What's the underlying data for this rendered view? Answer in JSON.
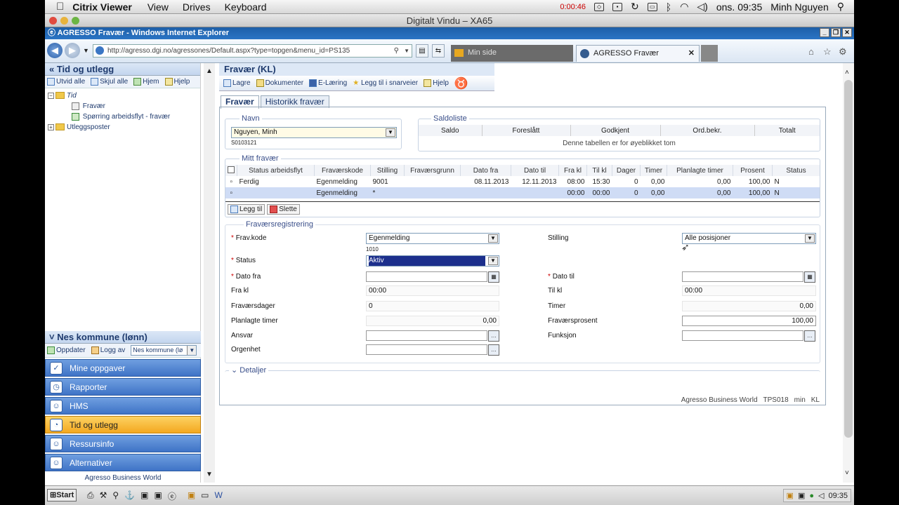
{
  "mac": {
    "apple": "",
    "app": "Citrix Viewer",
    "menus": [
      "View",
      "Drives",
      "Keyboard"
    ],
    "timer": "0:00:46",
    "clock": "ons. 09:35",
    "user": "Minh Nguyen"
  },
  "citrix": {
    "title": "Digitalt Vindu – XA65"
  },
  "ie": {
    "title": "AGRESSO Fravær - Windows Internet Explorer",
    "url": "http://agresso.dgi.no/agressones/Default.aspx?type=topgen&menu_id=PS135",
    "tab1": "Min side",
    "tab2": "AGRESSO Fravær",
    "close": "✕"
  },
  "left": {
    "heading": "Tid og utlegg",
    "tools": [
      "Utvid alle",
      "Skjul alle",
      "Hjem",
      "Hjelp"
    ],
    "tree": {
      "root": "Tid",
      "child1": "Fravær",
      "child2": "Spørring arbeidsflyt - fravær",
      "other": "Utleggsposter"
    },
    "company": "Nes kommune (lønn)",
    "tools2": [
      "Oppdater",
      "Logg av"
    ],
    "company_select": "Nes kommune (lø",
    "nav": [
      "Mine oppgaver",
      "Rapporter",
      "HMS",
      "Tid og utlegg",
      "Ressursinfo",
      "Alternativer"
    ],
    "footer": "Agresso Business World"
  },
  "page": {
    "title": "Fravær (KL)",
    "toolbar": [
      "Lagre",
      "Dokumenter",
      "E-Læring",
      "Legg til i snarveier",
      "Hjelp"
    ],
    "tabs": [
      "Fravær",
      "Historikk fravær"
    ],
    "navn": {
      "label": "Navn",
      "value": "Nguyen, Minh",
      "id": "S0103121"
    },
    "saldo": {
      "label": "Saldoliste",
      "cols": [
        "Saldo",
        "Foreslått",
        "Godkjent",
        "Ord.bekr.",
        "Totalt"
      ],
      "empty": "Denne tabellen er for øyeblikket tom"
    },
    "mitt": {
      "label": "Mitt fravær",
      "cols": [
        "Status arbeidsflyt",
        "Fraværskode",
        "Stilling",
        "Fraværsgrunn",
        "Dato fra",
        "Dato til",
        "Fra kl",
        "Til kl",
        "Dager",
        "Timer",
        "Planlagte timer",
        "Prosent",
        "Status"
      ],
      "rows": [
        [
          "Ferdig",
          "Egenmelding",
          "9001",
          "",
          "08.11.2013",
          "12.11.2013",
          "08:00",
          "15:30",
          "0",
          "0,00",
          "0,00",
          "100,00",
          "N"
        ],
        [
          "",
          "Egenmelding",
          "*",
          "",
          "",
          "",
          "00:00",
          "00:00",
          "0",
          "0,00",
          "0,00",
          "100,00",
          "N"
        ]
      ],
      "add": "Legg til",
      "delete": "Slette"
    },
    "reg": {
      "label": "Fraværsregistrering",
      "frav_kode": {
        "label": "Frav.kode",
        "value": "Egenmelding",
        "sub": "1010"
      },
      "stilling": {
        "label": "Stilling",
        "value": "Alle posisjoner"
      },
      "status": {
        "label": "Status",
        "value": "Aktiv"
      },
      "dato_fra": {
        "label": "Dato fra",
        "value": ""
      },
      "dato_til": {
        "label": "Dato til",
        "value": ""
      },
      "fra_kl": {
        "label": "Fra kl",
        "value": "00:00"
      },
      "til_kl": {
        "label": "Til kl",
        "value": "00:00"
      },
      "dager": {
        "label": "Fraværsdager",
        "value": "0"
      },
      "timer": {
        "label": "Timer",
        "value": "0,00"
      },
      "plan": {
        "label": "Planlagte timer",
        "value": "0,00"
      },
      "prosent": {
        "label": "Fraværsprosent",
        "value": "100,00"
      },
      "ansvar": {
        "label": "Ansvar",
        "value": ""
      },
      "funksjon": {
        "label": "Funksjon",
        "value": ""
      },
      "orgenhet": {
        "label": "Orgenhet",
        "value": ""
      }
    },
    "detaljer": "Detaljer",
    "footer": [
      "Agresso Business World",
      "TPS018",
      "min",
      "KL"
    ]
  },
  "taskbar": {
    "start": "Start",
    "clock": "09:35"
  }
}
